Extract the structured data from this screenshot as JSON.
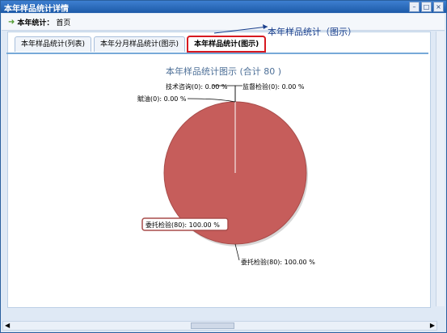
{
  "window": {
    "title": "本年样品统计详情"
  },
  "breadcrumb": {
    "label": "本年统计：",
    "current": "首页"
  },
  "tabs": [
    "本年样品统计(列表)",
    "本年分月样品统计(图示)",
    "本年样品统计(图示)"
  ],
  "annotation": "本年样品统计（图示）",
  "chart_title": "本年样品统计图示 (合计 80 )",
  "chart_data": {
    "type": "pie",
    "title": "本年样品统计图示 (合计 80 )",
    "total": 80,
    "slices": [
      {
        "name": "技术咨询",
        "value": 0,
        "percent": 0.0,
        "label": "技术咨询(0): 0.00 %"
      },
      {
        "name": "监督检验",
        "value": 0,
        "percent": 0.0,
        "label": "监督检验(0): 0.00 %"
      },
      {
        "name": "赋油",
        "value": 0,
        "percent": 0.0,
        "label": "賦油(0): 0.00 %"
      },
      {
        "name": "委托检验",
        "value": 80,
        "percent": 100.0,
        "label": "委托检验(80): 100.00 %"
      }
    ],
    "tooltip": "委托检验(80): 100.00 %",
    "colors": {
      "slice": "#c65d5b",
      "border": "#a84d4b"
    }
  }
}
